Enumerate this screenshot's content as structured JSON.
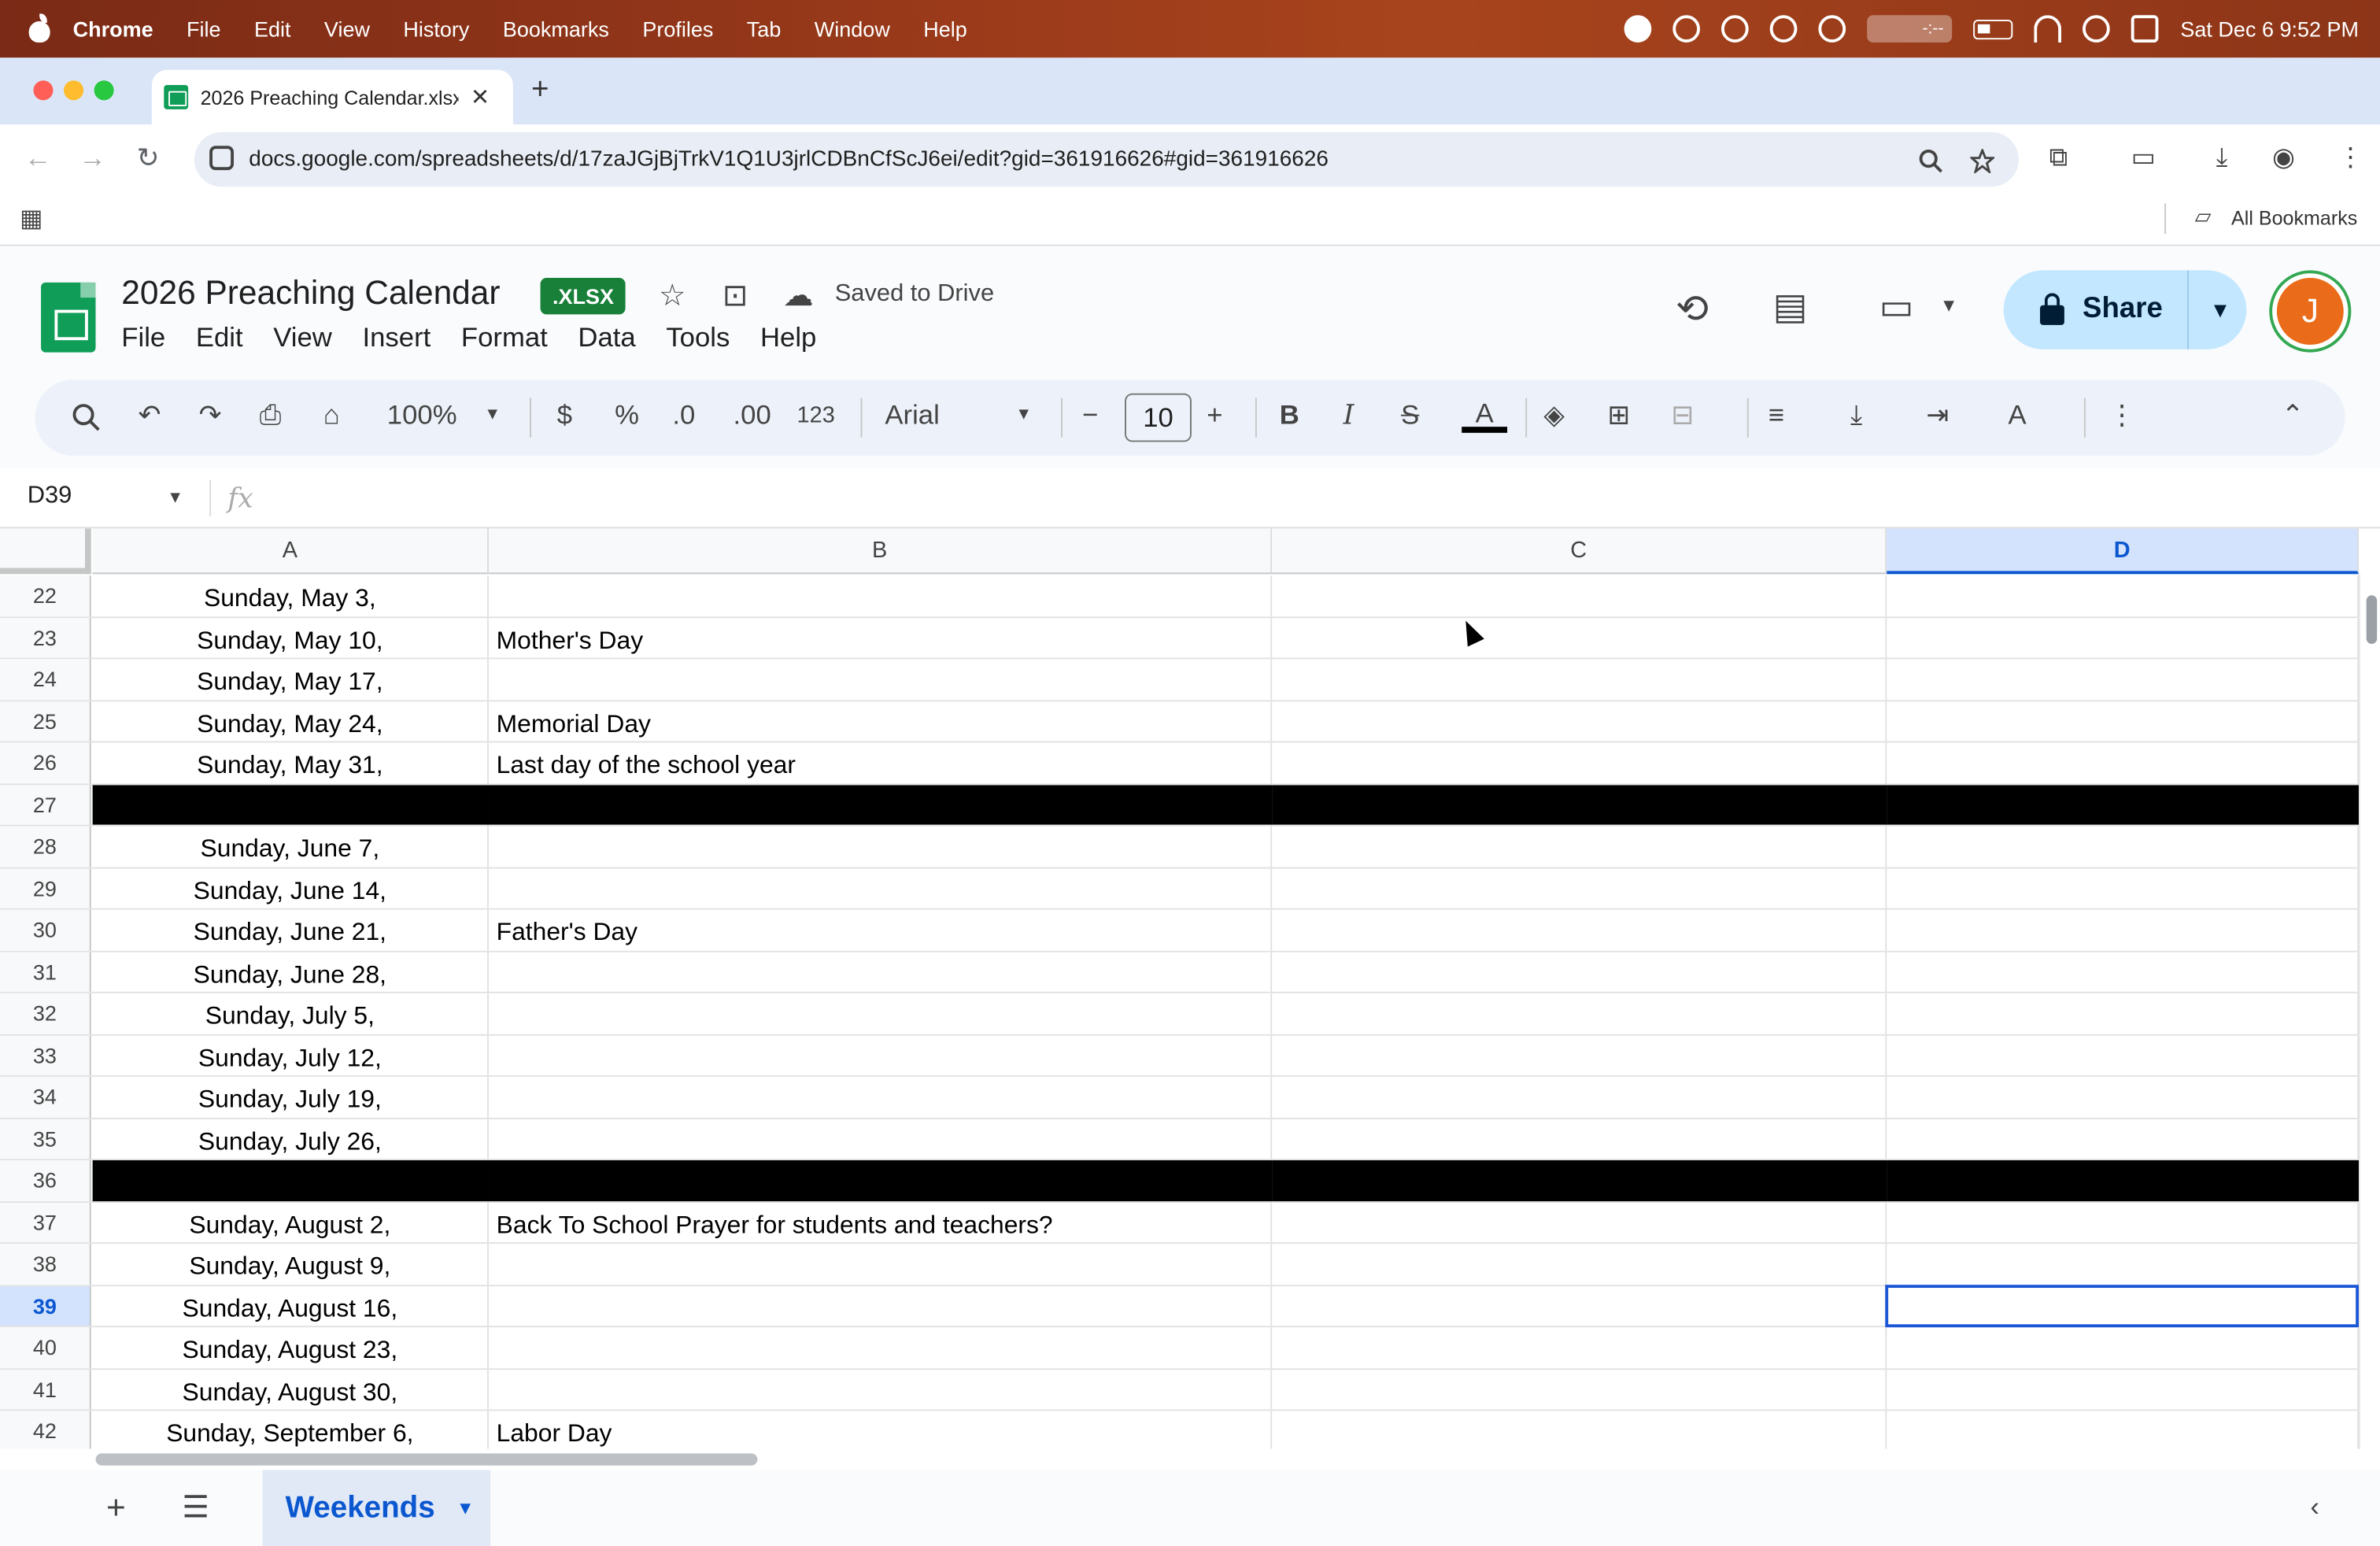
{
  "os_menubar": {
    "app": "Chrome",
    "items": [
      "File",
      "Edit",
      "View",
      "History",
      "Bookmarks",
      "Profiles",
      "Tab",
      "Window",
      "Help"
    ],
    "clock": "Sat Dec 6  9:52 PM",
    "video_label": "-:--"
  },
  "browser": {
    "tab_title": "2026 Preaching Calendar.xlsx",
    "url": "docs.google.com/spreadsheets/d/17zaJGjBjTrkV1Q1U3jrlCDBnCfScJ6ei/edit?gid=361916626#gid=361916626",
    "bookmarks_label": "All Bookmarks"
  },
  "doc": {
    "title": "2026 Preaching Calendar",
    "badge": ".XLSX",
    "save_status": "Saved to Drive",
    "menus": [
      "File",
      "Edit",
      "View",
      "Insert",
      "Format",
      "Data",
      "Tools",
      "Help"
    ],
    "share_label": "Share",
    "avatar_initial": "J"
  },
  "toolbar": {
    "zoom": "100%",
    "currency": "$",
    "percent": "%",
    "dec_decrease": ".0",
    "dec_increase": ".00",
    "number_format": "123",
    "font": "Arial",
    "font_size": "10",
    "bold": "B",
    "italic": "I",
    "text_color_label": "A"
  },
  "formula_bar": {
    "cell_ref": "D39",
    "fx": "fx",
    "value": ""
  },
  "columns": [
    "A",
    "B",
    "C",
    "D"
  ],
  "selected_column": "D",
  "rows": [
    {
      "n": "22",
      "a": "Sunday, May 3,",
      "b": ""
    },
    {
      "n": "23",
      "a": "Sunday, May 10,",
      "b": "Mother's Day"
    },
    {
      "n": "24",
      "a": "Sunday, May 17,",
      "b": ""
    },
    {
      "n": "25",
      "a": "Sunday, May 24,",
      "b": "Memorial Day"
    },
    {
      "n": "26",
      "a": "Sunday, May 31,",
      "b": "Last day of the school year"
    },
    {
      "n": "27",
      "a": "",
      "b": "",
      "black": true
    },
    {
      "n": "28",
      "a": "Sunday, June 7,",
      "b": ""
    },
    {
      "n": "29",
      "a": "Sunday, June 14,",
      "b": ""
    },
    {
      "n": "30",
      "a": "Sunday, June 21,",
      "b": "Father's Day"
    },
    {
      "n": "31",
      "a": "Sunday, June 28,",
      "b": ""
    },
    {
      "n": "32",
      "a": "Sunday, July 5,",
      "b": ""
    },
    {
      "n": "33",
      "a": "Sunday, July 12,",
      "b": ""
    },
    {
      "n": "34",
      "a": "Sunday, July 19,",
      "b": ""
    },
    {
      "n": "35",
      "a": "Sunday, July 26,",
      "b": ""
    },
    {
      "n": "36",
      "a": "",
      "b": "",
      "black": true
    },
    {
      "n": "37",
      "a": "Sunday, August 2,",
      "b": "Back To School Prayer for students and teachers?"
    },
    {
      "n": "38",
      "a": "Sunday, August 9,",
      "b": ""
    },
    {
      "n": "39",
      "a": "Sunday, August 16,",
      "b": "",
      "selected": true
    },
    {
      "n": "40",
      "a": "Sunday, August 23,",
      "b": ""
    },
    {
      "n": "41",
      "a": "Sunday, August 30,",
      "b": ""
    },
    {
      "n": "42",
      "a": "Sunday, September 6,",
      "b": "Labor Day"
    }
  ],
  "sheets": [
    {
      "name": "Weekends",
      "active": true
    }
  ]
}
